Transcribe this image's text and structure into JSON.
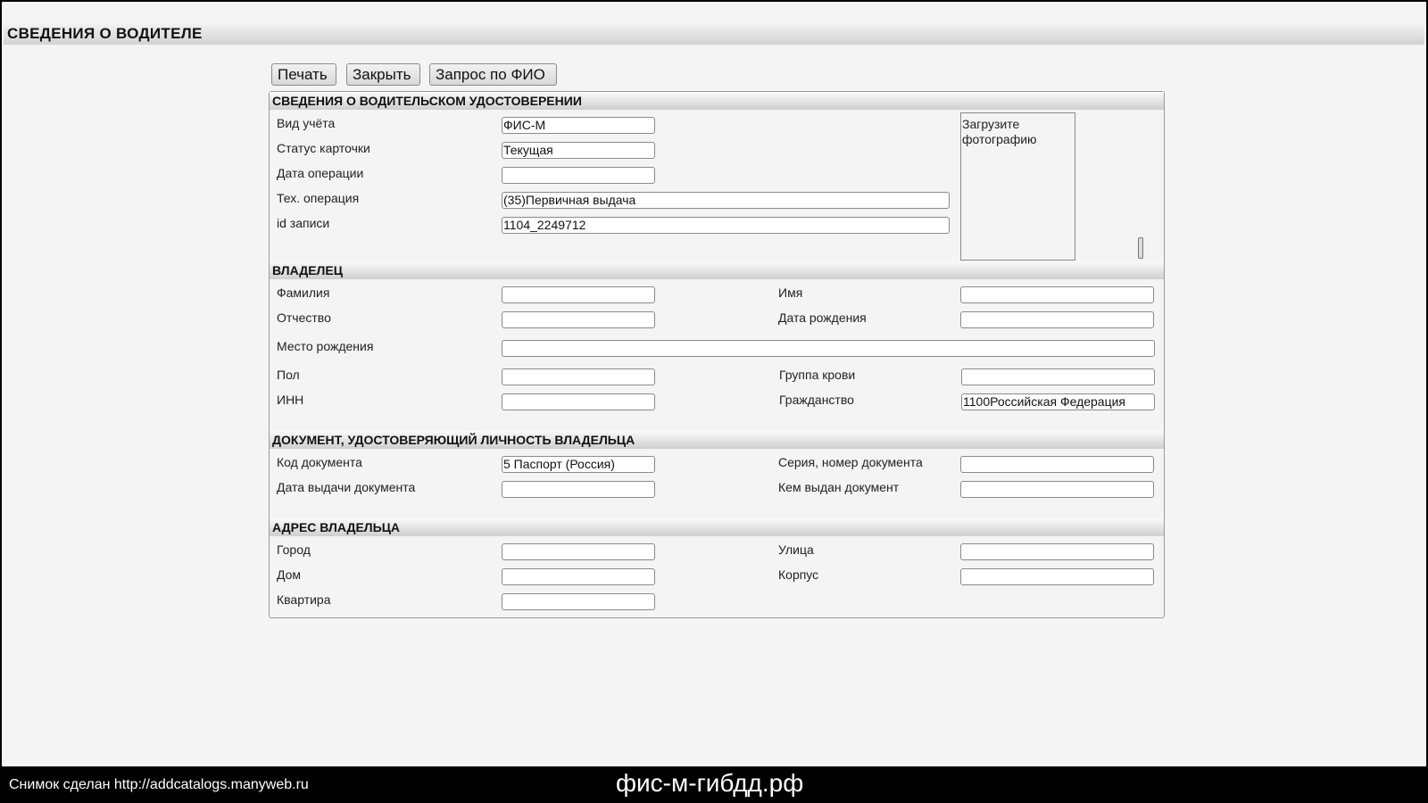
{
  "page": {
    "title": "СВЕДЕНИЯ О ВОДИТЕЛЕ"
  },
  "toolbar": {
    "print_label": "Печать",
    "close_label": "Закрыть",
    "query_label": "Запрос по ФИО"
  },
  "license": {
    "header": "СВЕДЕНИЯ О ВОДИТЕЛЬСКОМ УДОСТОВЕРЕНИИ",
    "account_type_label": "Вид учёта",
    "account_type_value": "ФИС-М",
    "card_status_label": "Статус карточки",
    "card_status_value": "Текущая",
    "operation_date_label": "Дата операции",
    "operation_date_value": "",
    "tech_operation_label": "Тех. операция",
    "tech_operation_value": "(35)Первичная выдача",
    "record_id_label": "id записи",
    "record_id_value": "1104_2249712",
    "photo_alt": "Загрузите фотографию"
  },
  "owner": {
    "header": "ВЛАДЕЛЕЦ",
    "surname_label": "Фамилия",
    "surname_value": "",
    "name_label": "Имя",
    "name_value": "",
    "patronymic_label": "Отчество",
    "patronymic_value": "",
    "birth_date_label": "Дата рождения",
    "birth_date_value": "",
    "birth_place_label": "Место рождения",
    "birth_place_value": "",
    "sex_label": "Пол",
    "sex_value": "",
    "blood_group_label": "Группа крови",
    "blood_group_value": "",
    "inn_label": "ИНН",
    "inn_value": "",
    "citizenship_label": "Гражданство",
    "citizenship_value": "1100Российская Федерация"
  },
  "document": {
    "header": "ДОКУМЕНТ, УДОСТОВЕРЯЮЩИЙ ЛИЧНОСТЬ ВЛАДЕЛЬЦА",
    "doc_code_label": "Код документа",
    "doc_code_value": "5 Паспорт (Россия)",
    "series_number_label": "Серия, номер документа",
    "series_number_value": "",
    "issue_date_label": "Дата выдачи документа",
    "issue_date_value": "",
    "issued_by_label": "Кем выдан документ",
    "issued_by_value": ""
  },
  "address": {
    "header": "АДРЕС ВЛАДЕЛЬЦА",
    "city_label": "Город",
    "city_value": "",
    "street_label": "Улица",
    "street_value": "",
    "house_label": "Дом",
    "house_value": "",
    "building_label": "Корпус",
    "building_value": "",
    "apartment_label": "Квартира",
    "apartment_value": ""
  },
  "footer": {
    "snapshot_text": "Снимок сделан http://addcatalogs.manyweb.ru",
    "watermark": "фис-м-гибдд.рф"
  }
}
